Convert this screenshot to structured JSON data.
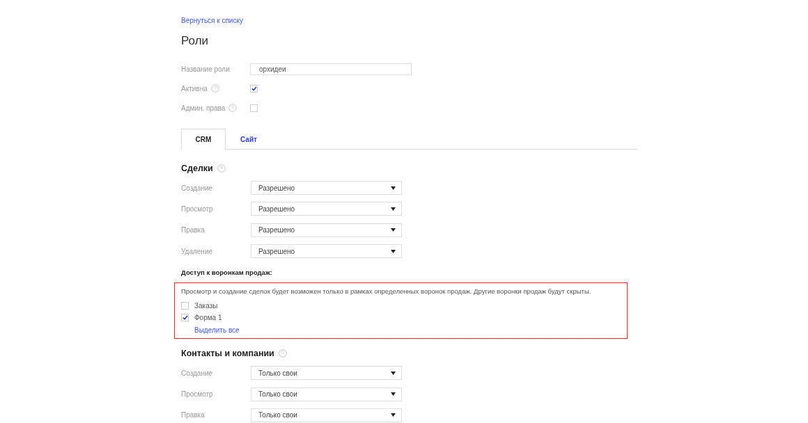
{
  "back_link": "Вернуться к списку",
  "title": "Роли",
  "fields": [
    {
      "kind": "text",
      "label": "Название роли",
      "help": false,
      "value": "орхидеи"
    },
    {
      "kind": "checkbox",
      "label": "Активна",
      "help": true,
      "checked": true
    },
    {
      "kind": "checkbox",
      "label": "Админ. права",
      "help": true,
      "checked": false
    }
  ],
  "tabs": [
    {
      "label": "CRM",
      "selected": true
    },
    {
      "label": "Сайт",
      "selected": false
    }
  ],
  "deals": {
    "title": "Сделки",
    "help": true,
    "rows": [
      {
        "label": "Создание",
        "value": "Разрешено"
      },
      {
        "label": "Просмотр",
        "value": "Разрешено"
      },
      {
        "label": "Правка",
        "value": "Разрешено"
      },
      {
        "label": "Удаление",
        "value": "Разрешено"
      }
    ]
  },
  "pipelines": {
    "title": "Доступ к воронкам продаж:",
    "highlighted": true,
    "note": "Просмотр и создание сделок будет возможен только в рамках определенных воронок продаж. Другие воронки продаж будут скрыты.",
    "items": [
      {
        "label": "Заказы",
        "checked": false
      },
      {
        "label": "Форма 1",
        "checked": true
      }
    ],
    "select_all": "Выделить все"
  },
  "contacts": {
    "title": "Контакты и компании",
    "help": true,
    "rows": [
      {
        "label": "Создание",
        "value": "Только свои"
      },
      {
        "label": "Просмотр",
        "value": "Только свои"
      },
      {
        "label": "Правка",
        "value": "Только свои"
      }
    ]
  }
}
